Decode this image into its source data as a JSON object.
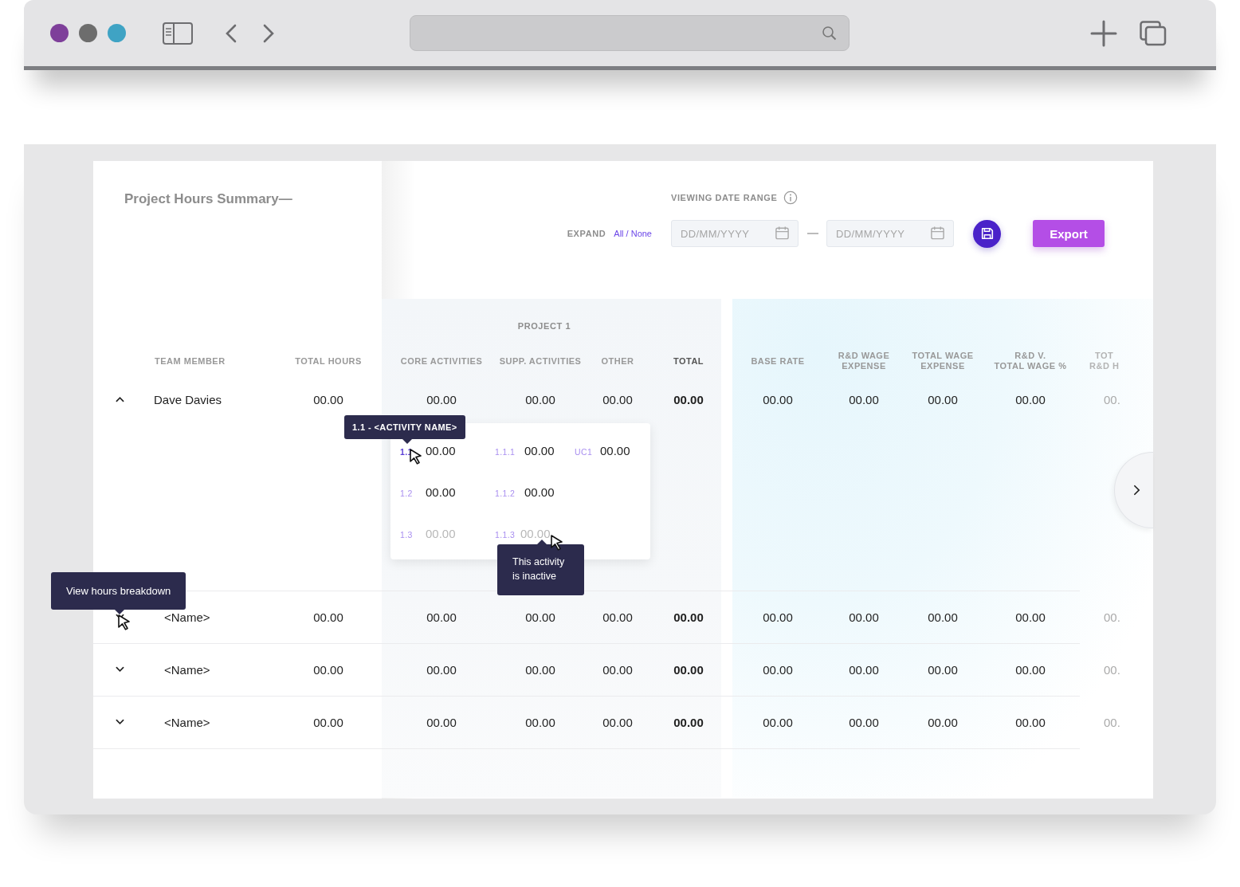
{
  "title": "Project Hours Summary—",
  "date_range": {
    "label": "VIEWING DATE RANGE",
    "start": {
      "placeholder": "DD/MM/YYYY"
    },
    "end": {
      "placeholder": "DD/MM/YYYY"
    }
  },
  "expand": {
    "label": "EXPAND",
    "link": "All / None"
  },
  "export_button": "Export",
  "table": {
    "group_label": "PROJECT 1",
    "columns": [
      {
        "lines": [
          "TEAM MEMBER"
        ],
        "emphasis": false,
        "faded": false
      },
      {
        "lines": [
          "TOTAL HOURS"
        ],
        "emphasis": false,
        "faded": false
      },
      {
        "lines": [
          "CORE ACTIVITIES"
        ],
        "emphasis": false,
        "faded": false
      },
      {
        "lines": [
          "SUPP. ACTIVITIES"
        ],
        "emphasis": false,
        "faded": false
      },
      {
        "lines": [
          "OTHER"
        ],
        "emphasis": false,
        "faded": false
      },
      {
        "lines": [
          "TOTAL"
        ],
        "emphasis": true,
        "faded": false
      },
      {
        "lines": [
          "BASE RATE"
        ],
        "emphasis": false,
        "faded": false
      },
      {
        "lines": [
          "R&D WAGE",
          "EXPENSE"
        ],
        "emphasis": false,
        "faded": false
      },
      {
        "lines": [
          "TOTAL WAGE",
          "EXPENSE"
        ],
        "emphasis": false,
        "faded": false
      },
      {
        "lines": [
          "R&D V.",
          "TOTAL WAGE %"
        ],
        "emphasis": false,
        "faded": false
      },
      {
        "lines": [
          "TOT",
          "R&D H"
        ],
        "emphasis": false,
        "faded": true
      }
    ],
    "rows": [
      {
        "name": "Dave Davies",
        "expanded": true,
        "values": [
          "00.00",
          "00.00",
          "00.00",
          "00.00",
          "00.00",
          "00.00",
          "00.00",
          "00.00",
          "00.00",
          "00."
        ],
        "breakdown": [
          [
            {
              "code": "1.1",
              "value": "00.00",
              "active": true,
              "highlighted": true
            },
            {
              "code": "1.1.1",
              "value": "00.00",
              "active": true,
              "highlighted": false
            },
            {
              "code": "UC1",
              "value": "00.00",
              "active": true,
              "highlighted": false
            }
          ],
          [
            {
              "code": "1.2",
              "value": "00.00",
              "active": true,
              "highlighted": false
            },
            {
              "code": "1.1.2",
              "value": "00.00",
              "active": true,
              "highlighted": false
            }
          ],
          [
            {
              "code": "1.3",
              "value": "00.00",
              "active": false,
              "highlighted": false
            },
            {
              "code": "1.1.3",
              "value": "00.00",
              "active": false,
              "highlighted": false
            }
          ]
        ]
      },
      {
        "name": "<Name>",
        "expanded": false,
        "values": [
          "00.00",
          "00.00",
          "00.00",
          "00.00",
          "00.00",
          "00.00",
          "00.00",
          "00.00",
          "00.00",
          "00."
        ]
      },
      {
        "name": "<Name>",
        "expanded": false,
        "values": [
          "00.00",
          "00.00",
          "00.00",
          "00.00",
          "00.00",
          "00.00",
          "00.00",
          "00.00",
          "00.00",
          "00."
        ]
      },
      {
        "name": "<Name>",
        "expanded": false,
        "values": [
          "00.00",
          "00.00",
          "00.00",
          "00.00",
          "00.00",
          "00.00",
          "00.00",
          "00.00",
          "00.00",
          "00."
        ]
      }
    ]
  },
  "tooltips": [
    {
      "text": "1.1 - <ACTIVITY NAME>"
    },
    {
      "text": "This activity is inactive"
    },
    {
      "text": "View hours breakdown"
    }
  ]
}
